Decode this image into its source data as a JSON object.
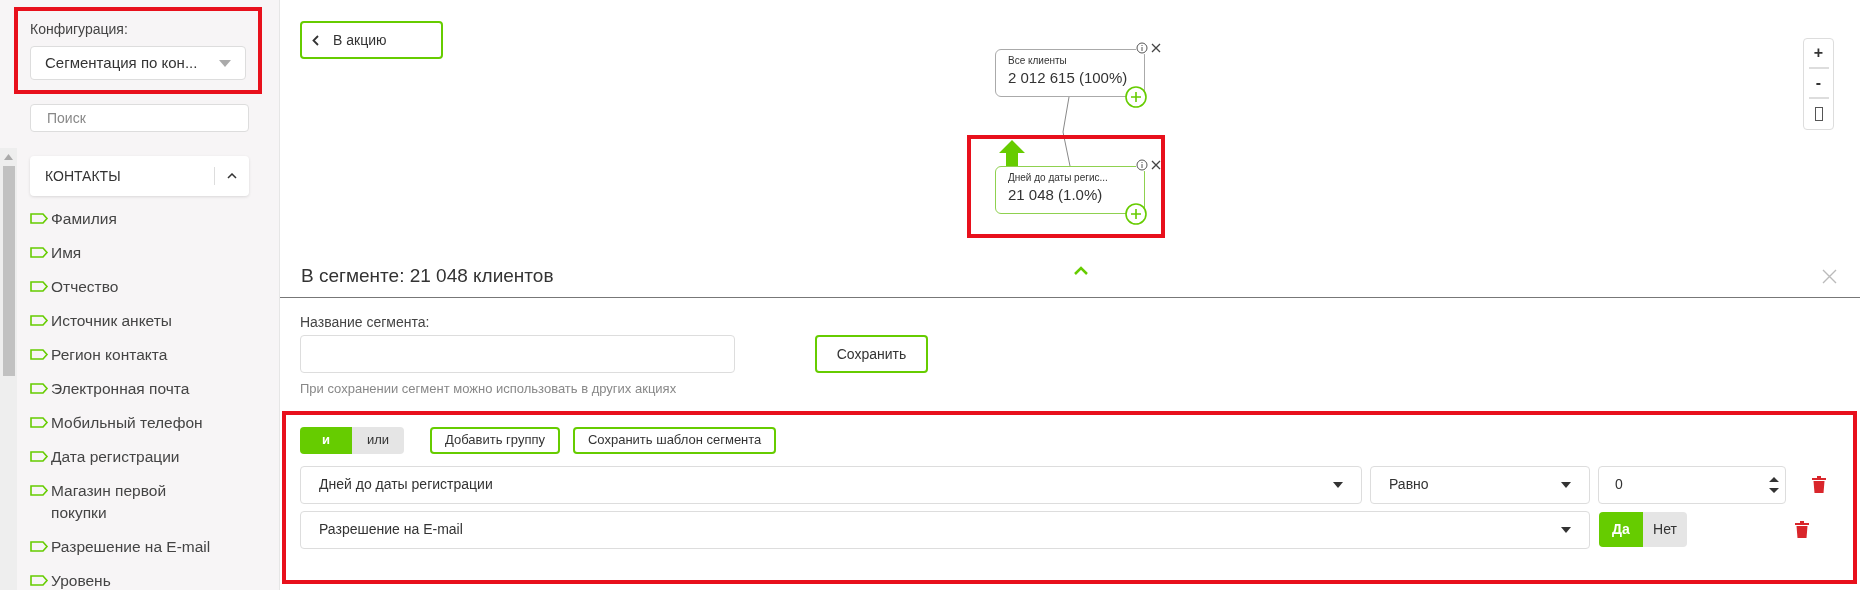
{
  "sidebar": {
    "config_label": "Конфигурация:",
    "config_value": "Сегментация по кон...",
    "search_placeholder": "Поиск",
    "group": {
      "title": "КОНТАКТЫ",
      "expanded": true
    },
    "items": [
      "Фамилия",
      "Имя",
      "Отчество",
      "Источник анкеты",
      "Регион контакта",
      "Электронная почта",
      "Мобильный телефон",
      "Дата регистрации",
      "Магазин первой покупки",
      "Разрешение на E-mail",
      "Уровень"
    ]
  },
  "back_button": "В акцию",
  "graph": {
    "nodes": [
      {
        "title": "Все клиенты",
        "count": "2 012 615 (100%)",
        "selected": false
      },
      {
        "title": "Дней до даты регис...",
        "count": "21 048 (1.0%)",
        "selected": true
      }
    ]
  },
  "zoom_controls": [
    "+",
    "-"
  ],
  "segment": {
    "heading": "В сегменте: 21 048 клиентов",
    "name_label": "Название сегмента:",
    "save_button": "Сохранить",
    "hint": "При сохранении сегмент можно использовать в других акциях"
  },
  "conditions": {
    "logic": [
      {
        "label": "и",
        "selected": true
      },
      {
        "label": "или",
        "selected": false
      }
    ],
    "buttons": [
      "Добавить группу",
      "Сохранить шаблон сегмента"
    ],
    "rows": [
      {
        "kind": "number",
        "field": "Дней до даты регистрации",
        "operator": "Равно",
        "value": "0"
      },
      {
        "kind": "boolean",
        "field": "Разрешение на E-mail",
        "options": [
          {
            "label": "Да",
            "selected": true
          },
          {
            "label": "Нет",
            "selected": false
          }
        ]
      }
    ]
  }
}
